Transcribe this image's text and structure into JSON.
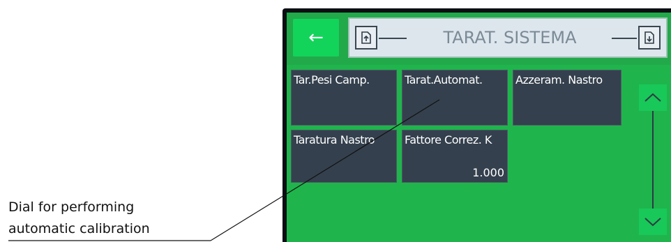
{
  "header": {
    "back_glyph": "←",
    "title": "TARAT. SISTEMA",
    "upload_icon": "file-upload-icon",
    "download_icon": "file-download-icon"
  },
  "tiles": [
    {
      "label": "Tar.Pesi Camp.",
      "value": ""
    },
    {
      "label": "Tarat.Automat.",
      "value": ""
    },
    {
      "label": "Azzeram. Nastro",
      "value": ""
    },
    {
      "label": "Taratura Nastro",
      "value": ""
    },
    {
      "label": "Fattore Correz. K",
      "value": "1.000"
    }
  ],
  "scroll": {
    "up_icon": "chevron-up-icon",
    "down_icon": "chevron-down-icon"
  },
  "annotation": {
    "line1": "Dial for performing",
    "line2": "automatic calibration"
  },
  "colors": {
    "screen_bg": "#1fb54c",
    "tile_bg": "#34404d",
    "accent": "#13d45a"
  }
}
